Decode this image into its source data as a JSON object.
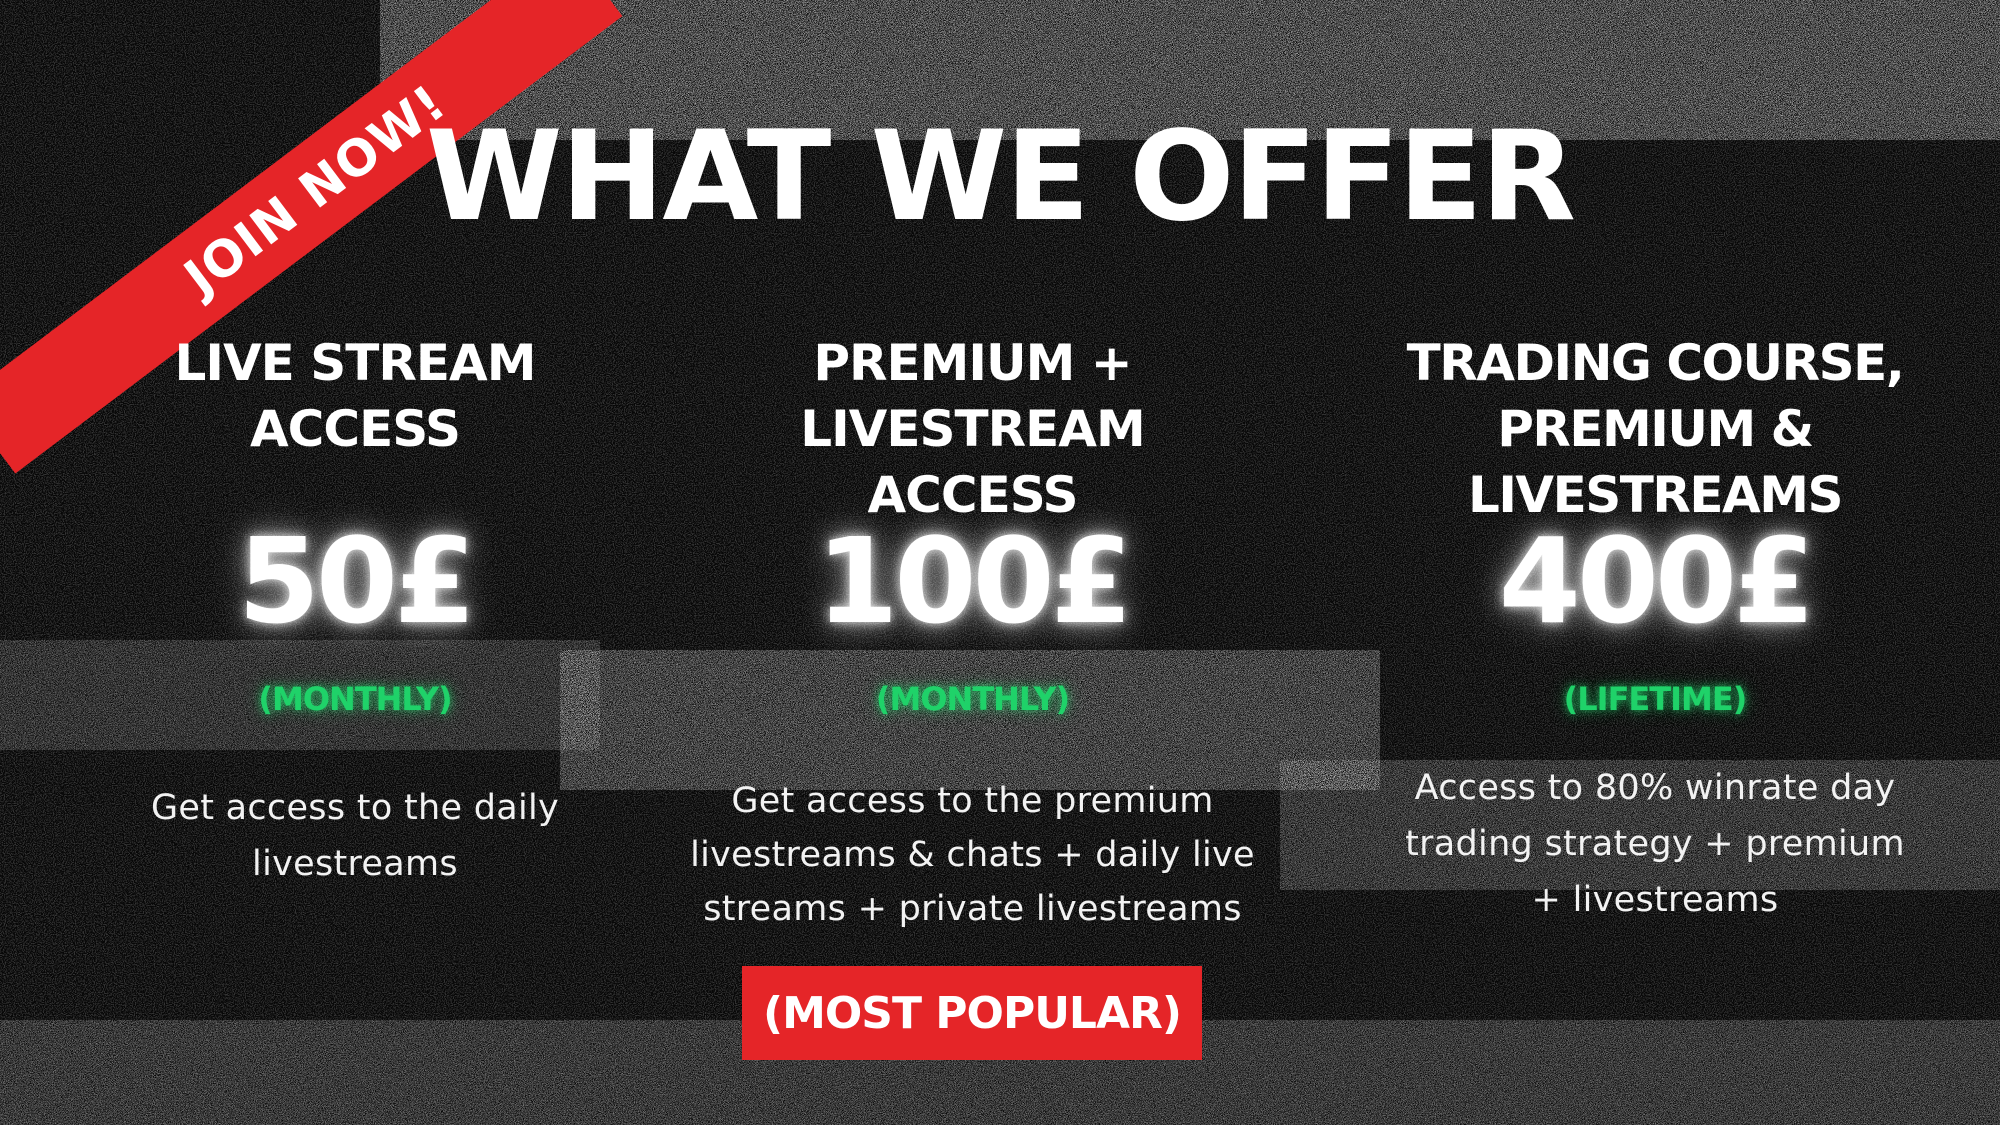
{
  "banner": {
    "ribbon_text": "JOIN NOW!",
    "ribbon_color": "#e52528"
  },
  "title": "WHAT WE OFFER",
  "plans": [
    {
      "name_line1": "LIVE STREAM",
      "name_line2": "ACCESS",
      "price": "50£",
      "period": "(MONTHLY)",
      "description_lines": [
        "Get access to the daily",
        "livestreams"
      ]
    },
    {
      "name_line1": "PREMIUM + LIVESTREAM",
      "name_line2": "ACCESS",
      "price": "100£",
      "period": "(MONTHLY)",
      "description_lines": [
        "Get access to the premium",
        "livestreams & chats + daily live",
        "streams + private livestreams"
      ],
      "badge": "(MOST POPULAR)"
    },
    {
      "name_line1": "TRADING COURSE,",
      "name_line2": "PREMIUM & LIVESTREAMS",
      "price": "400£",
      "period": "(LIFETIME)",
      "description_lines": [
        "Access to 80% winrate day",
        "trading strategy + premium",
        "+ livestreams"
      ]
    }
  ],
  "colors": {
    "background": "#060606",
    "accent_red": "#e52528",
    "period_green": "#1fd269",
    "text": "#ffffff"
  }
}
